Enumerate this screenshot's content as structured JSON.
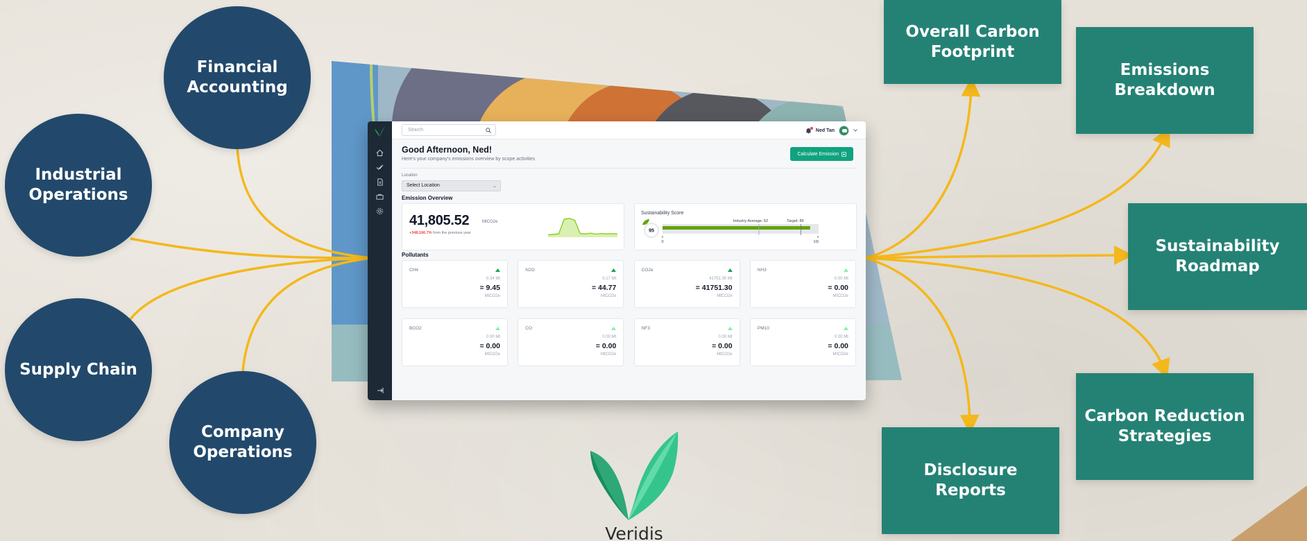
{
  "diagram": {
    "inputs": [
      "Financial\nAccounting",
      "Industrial\nOperations",
      "Supply Chain",
      "Company\nOperations"
    ],
    "outputs": [
      "Overall Carbon\nFootprint",
      "Emissions\nBreakdown",
      "Sustainability\nRoadmap",
      "Carbon Reduction\nStrategies",
      "Disclosure\nReports"
    ],
    "colors": {
      "input_fill": "#22496b",
      "output_fill": "#248275",
      "connector": "#f4b81c"
    }
  },
  "brand": {
    "name": "Veridis"
  },
  "app": {
    "search_placeholder": "Search",
    "user_name": "Ned Tan",
    "greeting": "Good Afternoon, Ned!",
    "subtitle": "Here's your company's emissions overview by scope activities",
    "calculate_button": "Calculate Emission",
    "location_label": "Location",
    "location_value": "Select Location",
    "overview_title": "Emission Overview",
    "total_value": "41,805.52",
    "total_unit": "MtCO2e",
    "change_value": "+348,166.7%",
    "change_text": "from the previous year",
    "sparkline": [
      0.05,
      0.08,
      0.1,
      0.85,
      0.9,
      0.8,
      0.12,
      0.1,
      0.14,
      0.09,
      0.12,
      0.1,
      0.11,
      0.1
    ],
    "score_title": "Sustainability Score",
    "score_value": "95",
    "industry_label": "Industry Average: 62",
    "target_label": "Target: 89",
    "score_scale_min": "0",
    "score_scale_max": "100",
    "score_fraction": 0.95,
    "pollutants_title": "Pollutants",
    "pollutants": [
      {
        "name": "CH4",
        "mt": "0.34 Mt",
        "value": "= 9.45",
        "unit": "MtCO2e",
        "arrow_color": "#16a34a"
      },
      {
        "name": "N2O",
        "mt": "0.17 Mt",
        "value": "= 44.77",
        "unit": "MtCO2e",
        "arrow_color": "#16a34a"
      },
      {
        "name": "CO2e",
        "mt": "41751.30 Mt",
        "value": "= 41751.30",
        "unit": "MtCO2e",
        "arrow_color": "#16a34a"
      },
      {
        "name": "NH3",
        "mt": "0.00 Mt",
        "value": "= 0.00",
        "unit": "MtCO2e",
        "arrow_color": "#86efac"
      },
      {
        "name": "BCO2",
        "mt": "0.00 Mt",
        "value": "= 0.00",
        "unit": "MtCO2e",
        "arrow_color": "#86efac"
      },
      {
        "name": "CO",
        "mt": "0.00 Mt",
        "value": "= 0.00",
        "unit": "MtCO2e",
        "arrow_color": "#86efac"
      },
      {
        "name": "NF3",
        "mt": "0.00 Mt",
        "value": "= 0.00",
        "unit": "MtCO2e",
        "arrow_color": "#86efac"
      },
      {
        "name": "PM10",
        "mt": "0.00 Mt",
        "value": "= 0.00",
        "unit": "MtCO2e",
        "arrow_color": "#86efac"
      }
    ]
  }
}
